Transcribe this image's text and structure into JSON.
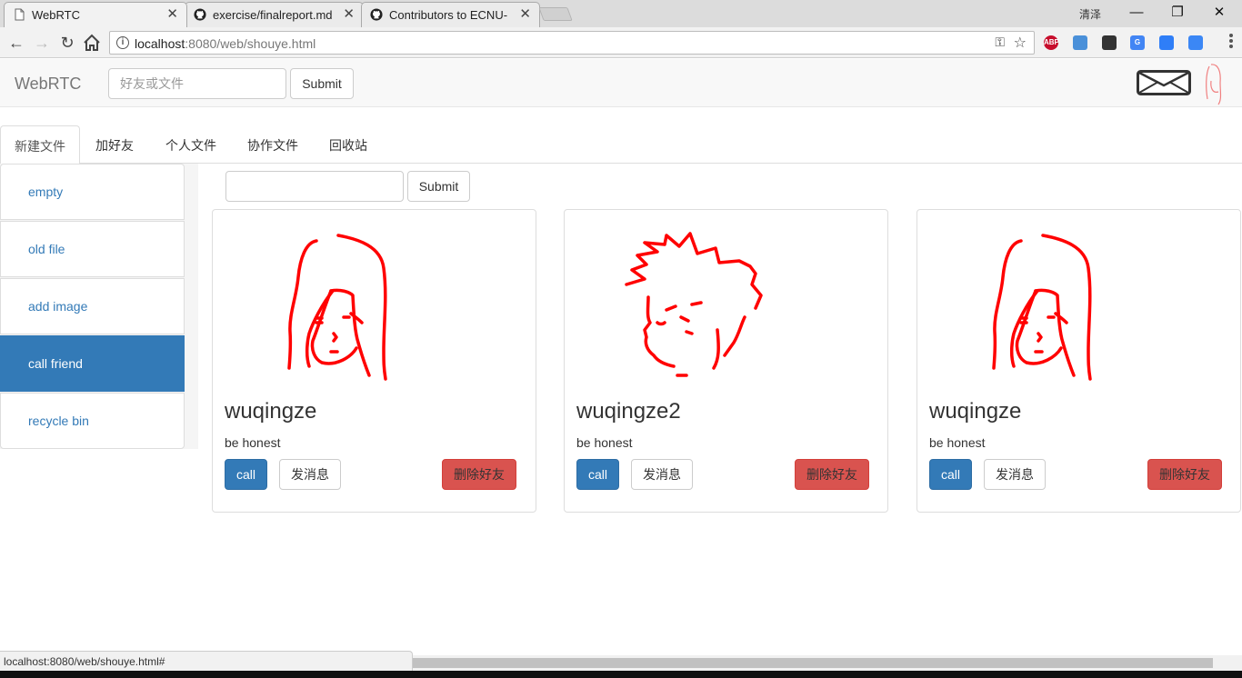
{
  "browser": {
    "tabs": [
      {
        "title": "WebRTC",
        "icon": "page-icon",
        "active": true
      },
      {
        "title": "exercise/finalreport.md",
        "icon": "github-icon",
        "active": false
      },
      {
        "title": "Contributors to ECNU-",
        "icon": "github-icon",
        "active": false
      }
    ],
    "user": "清泽",
    "url_host": "localhost",
    "url_rest": ":8080/web/shouye.html",
    "extensions": [
      {
        "name": "abp-icon",
        "label": "ABP",
        "color": "#c70d2c"
      },
      {
        "name": "bird-icon",
        "label": "",
        "color": "#4a90d9"
      },
      {
        "name": "location-icon",
        "label": "",
        "color": "#333333"
      },
      {
        "name": "translate-icon",
        "label": "G",
        "color": "#4285f4"
      },
      {
        "name": "edit-icon",
        "label": "",
        "color": "#2f7ef7"
      },
      {
        "name": "baidu-icon",
        "label": "",
        "color": "#3b87f5"
      }
    ]
  },
  "navbar": {
    "brand": "WebRTC",
    "search_placeholder": "好友或文件",
    "submit_label": "Submit"
  },
  "tabs": [
    {
      "label": "新建文件",
      "active": true
    },
    {
      "label": "加好友",
      "active": false
    },
    {
      "label": "个人文件",
      "active": false
    },
    {
      "label": "协作文件",
      "active": false
    },
    {
      "label": "回收站",
      "active": false
    }
  ],
  "sidebar": {
    "items": [
      {
        "label": "empty",
        "active": false
      },
      {
        "label": "old file",
        "active": false
      },
      {
        "label": "add image",
        "active": false
      },
      {
        "label": "call friend",
        "active": true
      },
      {
        "label": "recycle bin",
        "active": false
      }
    ]
  },
  "content": {
    "submit_label": "Submit",
    "friends": [
      {
        "name": "wuqingze",
        "motto": "be honest",
        "call_label": "call",
        "message_label": "发消息",
        "delete_label": "删除好友",
        "avatar": "girl-avatar"
      },
      {
        "name": "wuqingze2",
        "motto": "be honest",
        "call_label": "call",
        "message_label": "发消息",
        "delete_label": "删除好友",
        "avatar": "boy-avatar"
      },
      {
        "name": "wuqingze",
        "motto": "be honest",
        "call_label": "call",
        "message_label": "发消息",
        "delete_label": "删除好友",
        "avatar": "girl-avatar"
      }
    ]
  },
  "status_url": "localhost:8080/web/shouye.html#",
  "colors": {
    "primary": "#337ab7",
    "danger": "#d9534f",
    "sketch": "#ff0000"
  }
}
